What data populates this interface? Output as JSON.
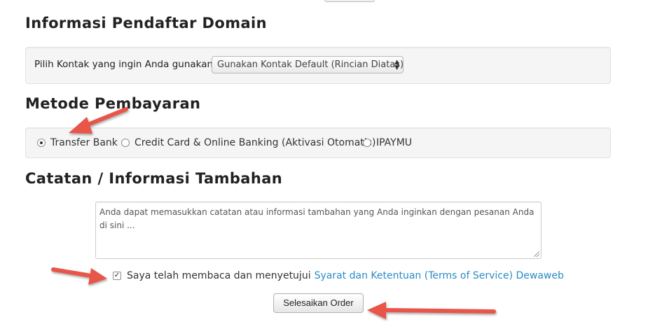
{
  "registrant": {
    "heading": "Informasi Pendaftar Domain",
    "contact_label": "Pilih Kontak yang ingin Anda gunakan:",
    "contact_select_value": "Gunakan Kontak Default (Rincian Diatas)"
  },
  "payment": {
    "heading": "Metode Pembayaran",
    "options": [
      {
        "label": "Transfer Bank",
        "selected": true
      },
      {
        "label": "Credit Card & Online Banking (Aktivasi Otomatis)",
        "selected": false
      },
      {
        "label": "IPAYMU",
        "selected": false
      }
    ]
  },
  "notes": {
    "heading": "Catatan / Informasi Tambahan",
    "textarea_value": "Anda dapat memasukkan catatan atau informasi tambahan yang Anda inginkan dengan pesanan Anda di sini ..."
  },
  "tos": {
    "checked": true,
    "text": "Saya telah membaca dan menyetujui",
    "link_text": "Syarat dan Ketentuan (Terms of Service) Dewaweb"
  },
  "submit": {
    "label": "Selesaikan Order"
  },
  "colors": {
    "annotation_arrow": "#e8554a",
    "link": "#2a8bc4",
    "well_background": "#f5f5f5"
  }
}
